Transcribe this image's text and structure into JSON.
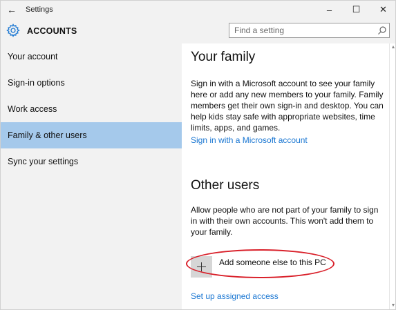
{
  "window": {
    "title": "Settings",
    "minimize_glyph": "–",
    "maximize_glyph": "☐",
    "close_glyph": "✕",
    "back_glyph": "←"
  },
  "header": {
    "section_title": "ACCOUNTS",
    "search_placeholder": "Find a setting",
    "accent_color": "#1976d2"
  },
  "sidebar": {
    "items": [
      {
        "label": "Your account"
      },
      {
        "label": "Sign-in options"
      },
      {
        "label": "Work access"
      },
      {
        "label": "Family & other users",
        "selected": true
      },
      {
        "label": "Sync your settings"
      }
    ],
    "selected_color": "#a5c9eb"
  },
  "main": {
    "family": {
      "title": "Your family",
      "description": "Sign in with a Microsoft account to see your family here or add any new members to your family. Family members get their own sign-in and desktop. You can help kids stay safe with appropriate websites, time limits, apps, and games.",
      "signin_link": "Sign in with a Microsoft account"
    },
    "other_users": {
      "title": "Other users",
      "description": "Allow people who are not part of your family to sign in with their own accounts. This won't add them to your family.",
      "add_label": "Add someone else to this PC",
      "add_icon": "plus-icon",
      "assigned_access_link": "Set up assigned access"
    },
    "annotation_color": "#d9202a"
  }
}
